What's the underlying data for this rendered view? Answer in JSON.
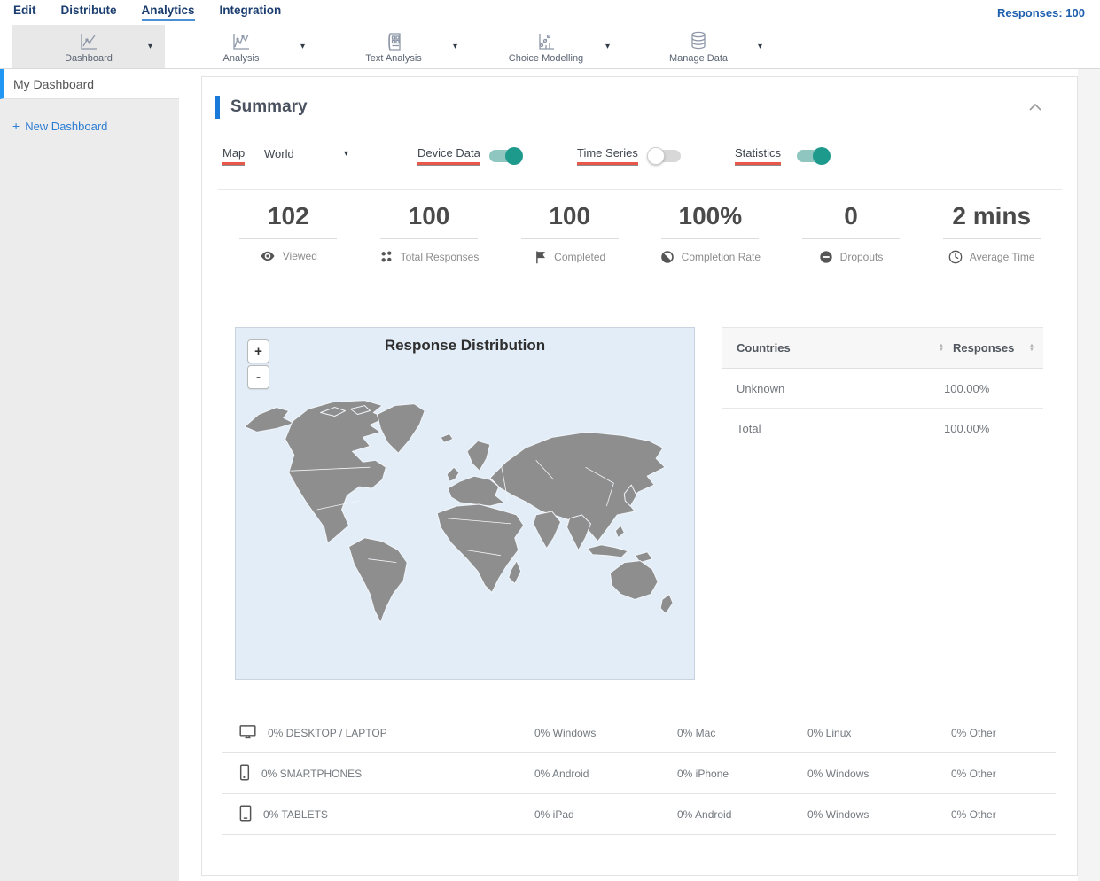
{
  "topnav": {
    "items": [
      {
        "label": "Edit"
      },
      {
        "label": "Distribute"
      },
      {
        "label": "Analytics"
      },
      {
        "label": "Integration"
      }
    ],
    "responses": "Responses: 100"
  },
  "toolbar": {
    "items": [
      {
        "label": "Dashboard",
        "icon": "line-chart-icon",
        "selected": true
      },
      {
        "label": "Analysis",
        "icon": "line-chart-icon",
        "selected": false
      },
      {
        "label": "Text Analysis",
        "icon": "document-grid-icon",
        "selected": false
      },
      {
        "label": "Choice Modelling",
        "icon": "scatter-chart-icon",
        "selected": false
      },
      {
        "label": "Manage Data",
        "icon": "database-icon",
        "selected": false
      }
    ]
  },
  "sidebar": {
    "active_item": "My Dashboard",
    "plus": "+",
    "new_dashboard": "New Dashboard"
  },
  "summary": {
    "title": "Summary",
    "controls": {
      "map_label": "Map",
      "map_value": "World",
      "device_data_label": "Device Data",
      "time_series_label": "Time Series",
      "statistics_label": "Statistics",
      "device_data_on": true,
      "time_series_on": false,
      "statistics_on": true
    },
    "stats": [
      {
        "value": "102",
        "label": "Viewed",
        "icon": "eye-icon"
      },
      {
        "value": "100",
        "label": "Total Responses",
        "icon": "grid-dots-icon"
      },
      {
        "value": "100",
        "label": "Completed",
        "icon": "flag-icon"
      },
      {
        "value": "100%",
        "label": "Completion Rate",
        "icon": "half-circle-icon"
      },
      {
        "value": "0",
        "label": "Dropouts",
        "icon": "minus-circle-icon"
      },
      {
        "value": "2 mins",
        "label": "Average Time",
        "icon": "clock-icon"
      }
    ],
    "map": {
      "title": "Response Distribution",
      "zoom_in": "+",
      "zoom_out": "-"
    },
    "countries_table": {
      "col_country": "Countries",
      "col_responses": "Responses",
      "rows": [
        {
          "country": "Unknown",
          "value": "100.00%"
        },
        {
          "country": "Total",
          "value": "100.00%"
        }
      ]
    },
    "device_table": {
      "rows": [
        {
          "icon": "desktop-icon",
          "category": "0% DESKTOP / LAPTOP",
          "col1": "0% Windows",
          "col2": "0% Mac",
          "col3": "0% Linux",
          "col4": "0% Other"
        },
        {
          "icon": "smartphone-icon",
          "category": "0% SMARTPHONES",
          "col1": "0% Android",
          "col2": "0% iPhone",
          "col3": "0% Windows",
          "col4": "0% Other"
        },
        {
          "icon": "tablet-icon",
          "category": "0% TABLETS",
          "col1": "0% iPad",
          "col2": "0% Android",
          "col3": "0% Windows",
          "col4": "0% Other"
        }
      ]
    }
  },
  "colors": {
    "nav_navy": "#1b3e6f",
    "nav_underline_blue": "#4a90d2",
    "link_blue": "#1d5fae",
    "accent_blue": "#1a7ad9",
    "sidebar_active_blue": "#2196f3",
    "toggle_teal": "#1e9a8c",
    "toggle_track_teal": "#8fc6c0",
    "red_underline": "#e8584a",
    "map_background": "#e2edf8",
    "map_land": "#8e8e8e"
  }
}
